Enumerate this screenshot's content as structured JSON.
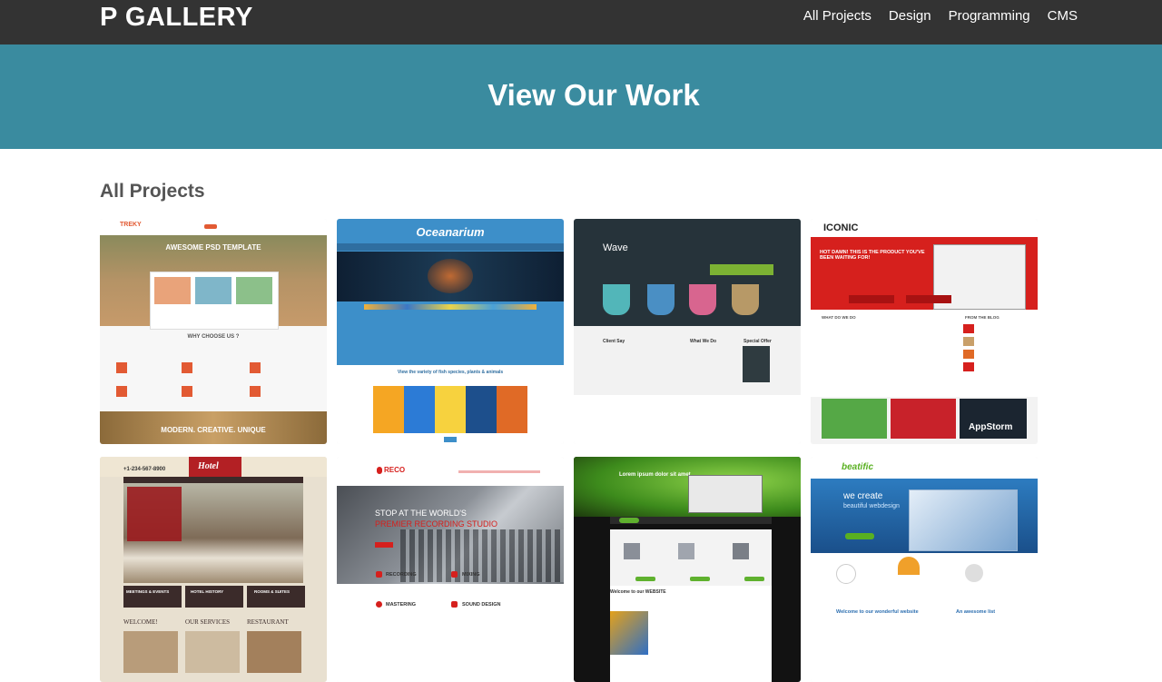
{
  "header": {
    "brand": "P GALLERY",
    "nav": [
      "All Projects",
      "Design",
      "Programming",
      "CMS"
    ]
  },
  "hero": {
    "title": "View Our Work"
  },
  "section": {
    "title": "All Projects"
  },
  "thumbnails": [
    {
      "texts": [
        "TREKY",
        "AWESOME PSD TEMPLATE",
        "WHY CHOOSE US ?",
        "MODERN. CREATIVE. UNIQUE"
      ]
    },
    {
      "texts": [
        "Oceanarium",
        "View the variety of fish species, plants & animals"
      ]
    },
    {
      "texts": [
        "Wave",
        "Client Say",
        "What We Do",
        "Special Offer"
      ]
    },
    {
      "texts": [
        "ICONIC",
        "HOT DAMN! THIS IS THE PRODUCT YOU'VE BEEN WAITING FOR!",
        "WHAT DO WE DO",
        "FROM THE BLOG",
        "AppStorm"
      ]
    },
    {
      "texts": [
        "Hotel",
        "+1-234-567-8900",
        "MEETINGS & EVENTS",
        "HOTEL HISTORY",
        "ROOMS & SUITES",
        "WELCOME!",
        "OUR SERVICES",
        "RESTAURANT"
      ]
    },
    {
      "texts": [
        "RECO",
        "STOP AT THE WORLD'S",
        "PREMIER RECORDING STUDIO",
        "RECORDING",
        "MIXING",
        "MASTERING",
        "SOUND DESIGN"
      ]
    },
    {
      "texts": [
        "Lorem ipsum dolor sit amet",
        "Welcome to our WEBSITE"
      ]
    },
    {
      "texts": [
        "beatific",
        "we create",
        "beautiful webdesign",
        "Welcome to our wonderful website",
        "An awesome list"
      ]
    }
  ],
  "colors": {
    "topbar": "#333333",
    "hero": "#3a8b9f",
    "section_title": "#555555"
  }
}
